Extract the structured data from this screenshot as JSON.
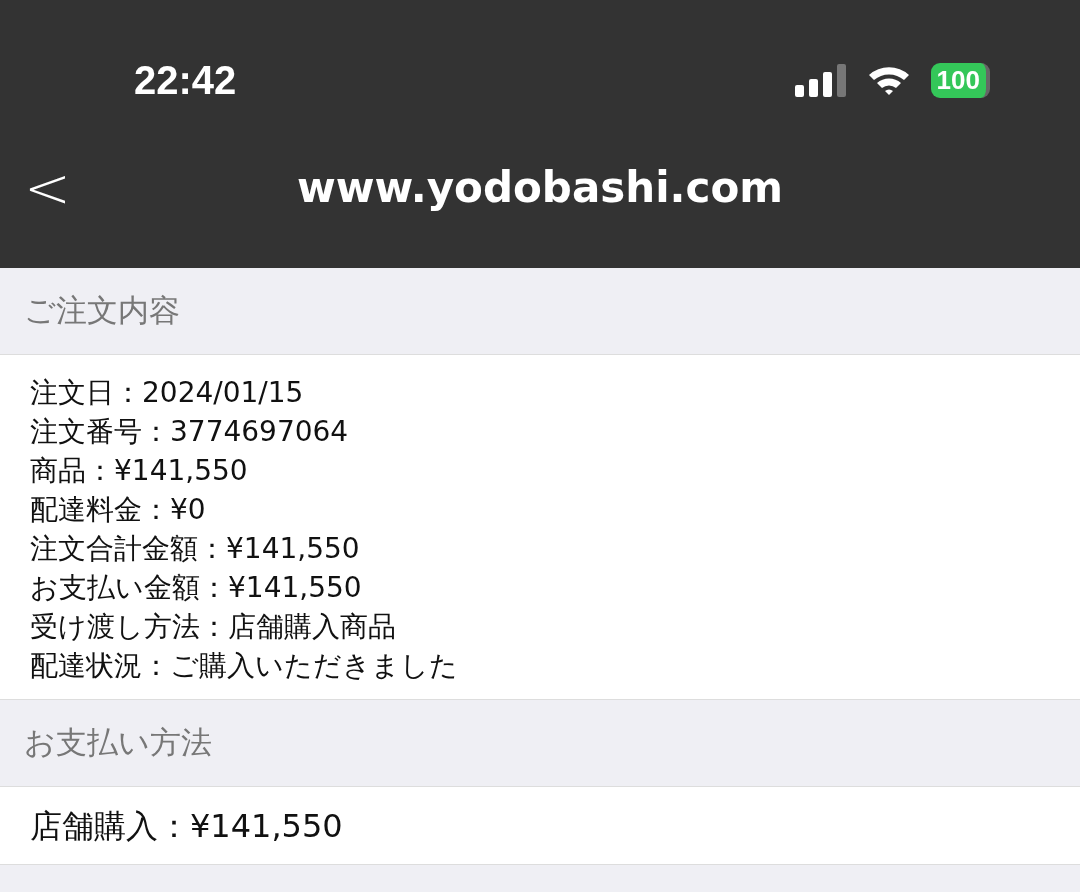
{
  "status_bar": {
    "time": "22:42",
    "battery": "100"
  },
  "nav": {
    "back": "<",
    "title": "www.yodobashi.com"
  },
  "sections": [
    {
      "header": "ご注文内容",
      "lines": [
        "注文日：2024/01/15",
        "注文番号：3774697064",
        "商品：¥141,550",
        "配達料金：¥0",
        "注文合計金額：¥141,550",
        "お支払い金額：¥141,550",
        "受け渡し方法：店舗購入商品",
        "配達状況：ご購入いただきました"
      ]
    },
    {
      "header": "お支払い方法",
      "lines": [
        "店舗購入：¥141,550"
      ]
    }
  ]
}
